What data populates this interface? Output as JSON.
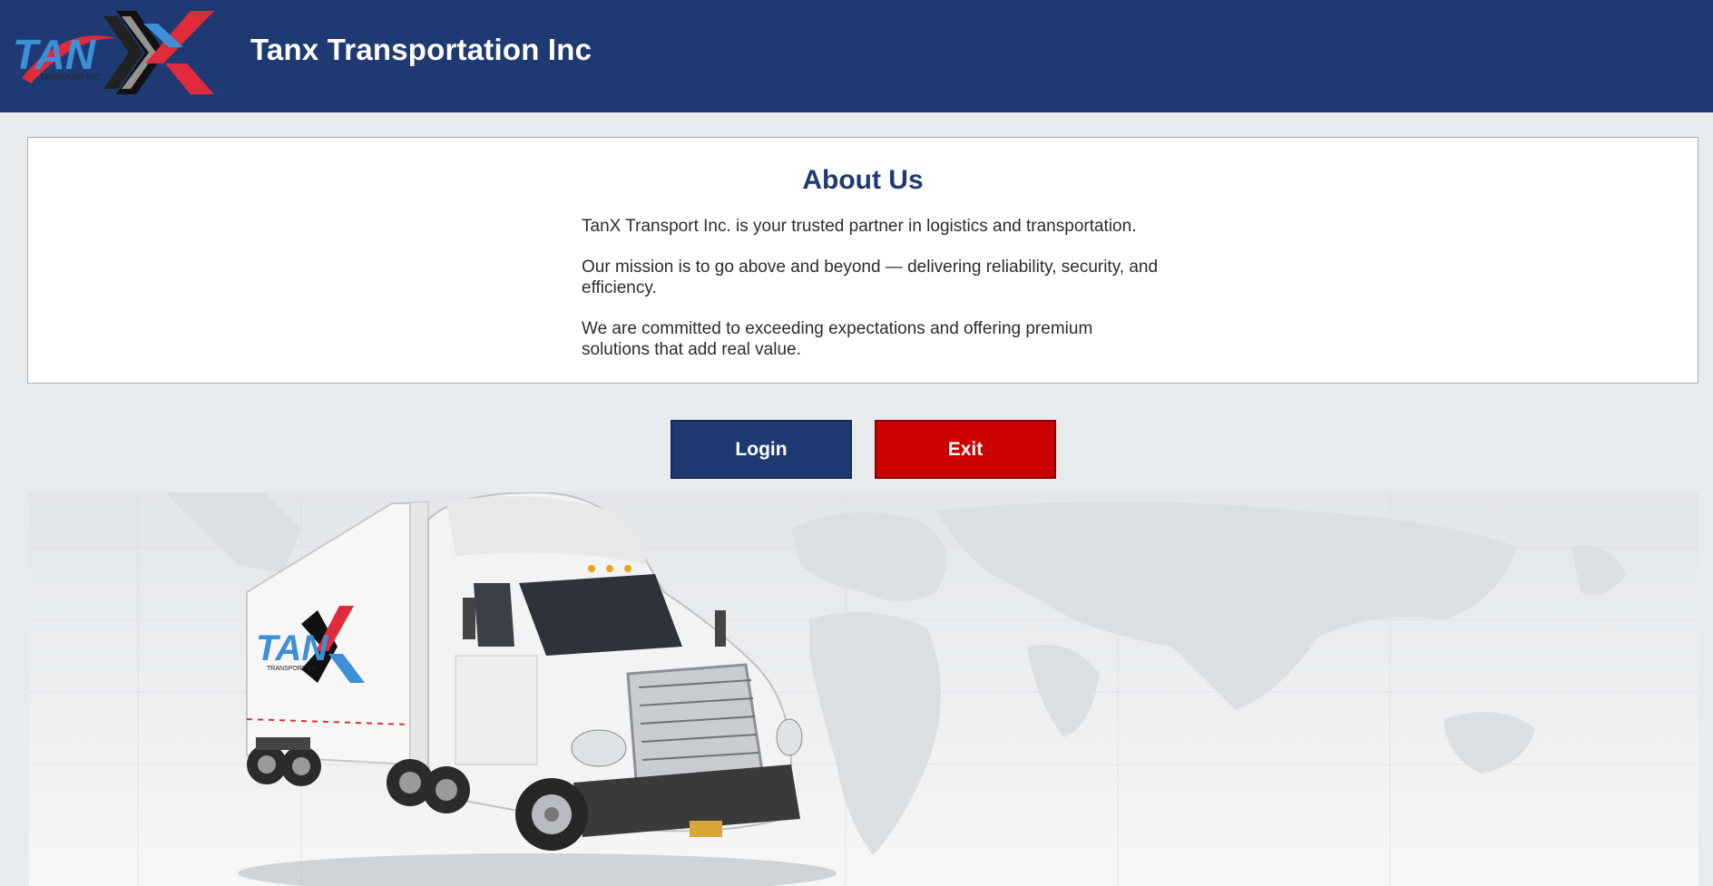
{
  "header": {
    "title": "Tanx Transportation Inc",
    "background_color": "#1f3a72"
  },
  "logo": {
    "wordmark": "TAN",
    "subtitle": "TRANSPORT INC",
    "icon": "tanx-logo"
  },
  "about": {
    "heading": "About Us",
    "paragraphs": [
      "TanX Transport Inc. is your trusted partner in logistics and transportation.",
      "Our mission is to go above and beyond — delivering reliability, security, and efficiency.",
      "We are committed to exceeding expectations and offering premium solutions that add real value."
    ],
    "heading_color": "#1f3a72"
  },
  "actions": {
    "login_label": "Login",
    "exit_label": "Exit",
    "login_color": "#1f3a72",
    "exit_color": "#cc0000"
  },
  "hero": {
    "image": "white-semi-truck-with-tanx-trailer-over-world-map",
    "trailer_logo": "TAN",
    "trailer_subtitle": "TRANSPORT INC"
  }
}
